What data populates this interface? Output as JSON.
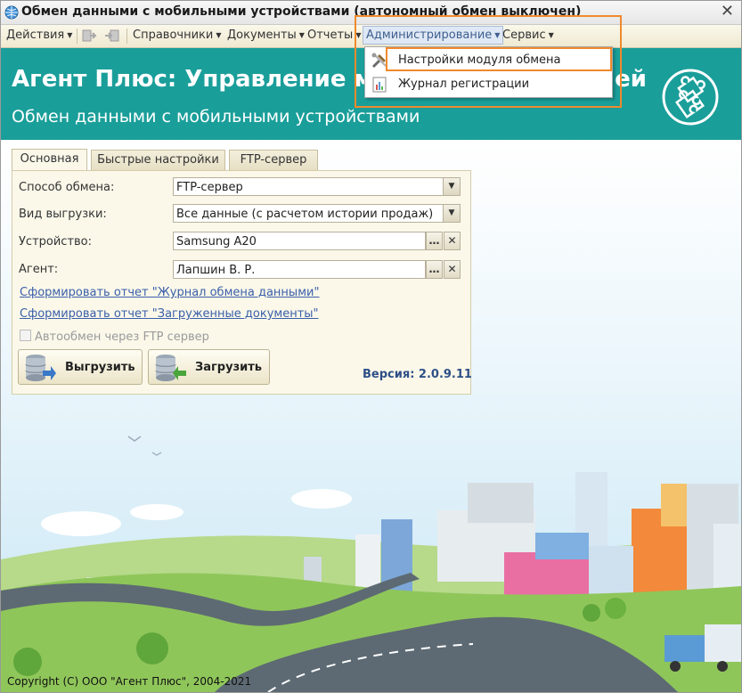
{
  "window": {
    "title": "Обмен данными с мобильными устройствами (автономный обмен выключен)"
  },
  "menu": {
    "actions": "Действия",
    "catalogs": "Справочники",
    "documents": "Документы",
    "reports": "Отчеты",
    "administration": "Администрирование",
    "service": "Сервис"
  },
  "dropdown": {
    "items": [
      {
        "label": "Настройки модуля обмена",
        "icon": "tools-icon"
      },
      {
        "label": "Журнал регистрации",
        "icon": "log-icon"
      }
    ]
  },
  "header": {
    "title": "Агент Плюс: Управление мобильной торговлей",
    "subtitle": "Обмен данными с мобильными устройствами",
    "logo_icon": "puzzle-icon"
  },
  "tabs": [
    "Основная",
    "Быстрые настройки",
    "FTP-сервер"
  ],
  "form": {
    "exchange_method_label": "Способ обмена:",
    "exchange_method_value": "FTP-сервер",
    "export_type_label": "Вид выгрузки:",
    "export_type_value": "Все данные (с расчетом истории продаж)",
    "device_label": "Устройство:",
    "device_value": "Samsung A20",
    "agent_label": "Агент:",
    "agent_value": "Лапшин В. Р.",
    "link_exchange_log": "Сформировать отчет \"Журнал обмена данными\"",
    "link_loaded_docs": "Сформировать отчет \"Загруженные документы\"",
    "auto_exchange_label": "Автообмен через FTP сервер",
    "auto_exchange_checked": false,
    "upload_button": "Выгрузить",
    "download_button": "Загрузить",
    "version": "Версия: 2.0.9.11"
  },
  "footer": {
    "copyright": "Copyright (C) ООО \"Агент Плюс\", 2004-2021"
  },
  "colors": {
    "header": "#1a9e9a",
    "highlight": "#f08a2c",
    "link": "#3a5fa8",
    "version": "#2e4f86"
  }
}
